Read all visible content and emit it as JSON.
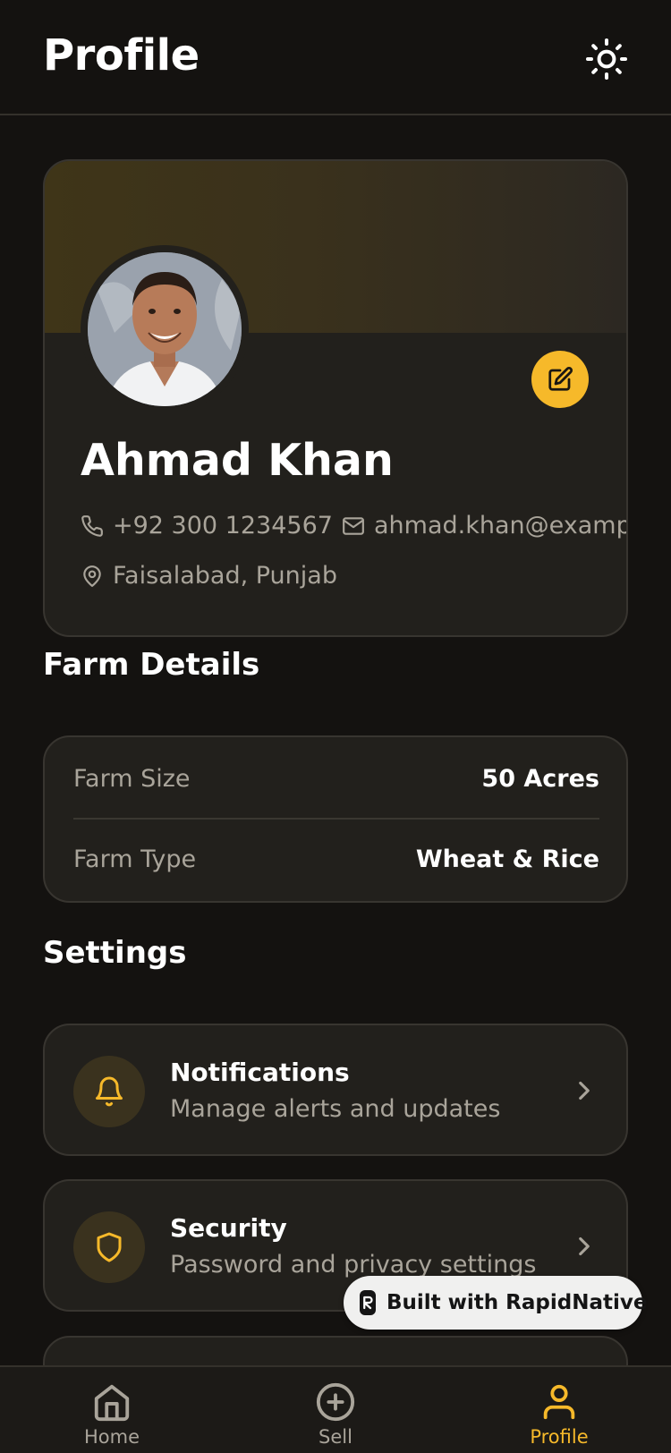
{
  "header": {
    "title": "Profile",
    "theme_icon": "sun-icon"
  },
  "profile": {
    "name": "Ahmad Khan",
    "phone": "+92 300 1234567",
    "email": "ahmad.khan@exampl",
    "location": "Faisalabad, Punjab",
    "edit_icon": "edit-icon"
  },
  "farm": {
    "section_title": "Farm Details",
    "rows": [
      {
        "label": "Farm Size",
        "value": "50 Acres"
      },
      {
        "label": "Farm Type",
        "value": "Wheat & Rice"
      }
    ]
  },
  "settings": {
    "section_title": "Settings",
    "items": [
      {
        "title": "Notifications",
        "subtitle": "Manage alerts and updates",
        "icon": "bell-icon"
      },
      {
        "title": "Security",
        "subtitle": "Password and privacy settings",
        "icon": "shield-icon"
      }
    ]
  },
  "badge": {
    "text": "Built with RapidNative"
  },
  "tabbar": {
    "tabs": [
      {
        "label": "Home",
        "icon": "home-icon",
        "active": false
      },
      {
        "label": "Sell",
        "icon": "plus-circle-icon",
        "active": false
      },
      {
        "label": "Profile",
        "icon": "user-icon",
        "active": true
      }
    ]
  },
  "colors": {
    "background": "#141210",
    "card": "#22201c",
    "accent": "#f6b92a",
    "muted_text": "#a9a49a"
  }
}
